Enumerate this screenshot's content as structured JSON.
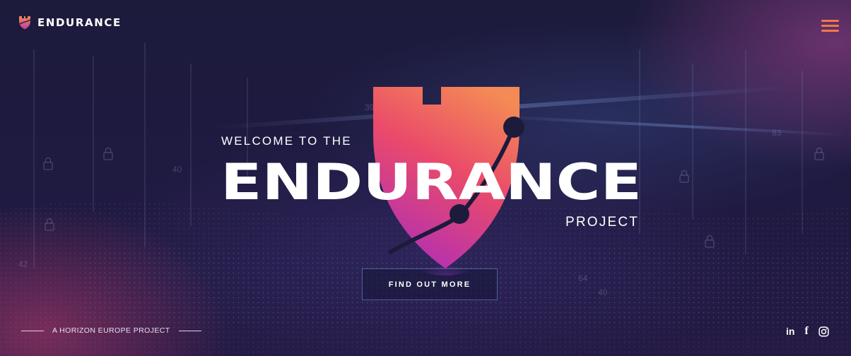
{
  "header": {
    "brand": "ENDURANCE",
    "menu_icon": "hamburger-menu-icon"
  },
  "hero": {
    "welcome": "WELCOME TO THE",
    "wordmark": "ENDURANCE",
    "subtitle": "PROJECT",
    "cta_label": "FIND OUT MORE",
    "background_numbers": [
      "40",
      "39",
      "83",
      "64",
      "42",
      "40"
    ]
  },
  "footer": {
    "tagline": "A HORIZON EUROPE PROJECT",
    "social": [
      {
        "label": "in",
        "icon": "linkedin-icon"
      },
      {
        "label": "f",
        "icon": "facebook-icon"
      },
      {
        "label": "",
        "icon": "instagram-icon"
      }
    ]
  },
  "colors": {
    "accent": "#f07a4a",
    "shield_top": "#f48a55",
    "shield_mid": "#e6406e",
    "shield_bottom": "#b82fb3",
    "background": "#1c1b3c"
  }
}
